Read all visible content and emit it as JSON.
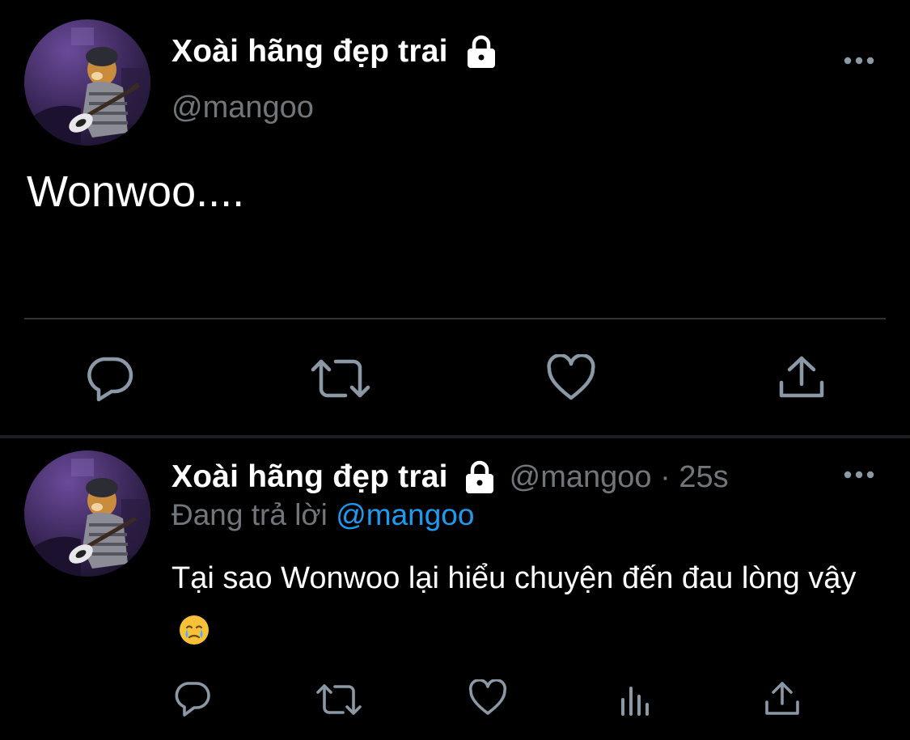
{
  "main_tweet": {
    "avatar": "dog-guitar-avatar",
    "display_name": "Xoài hãng đẹp trai",
    "handle": "@mangoo",
    "text": "Wonwoo....",
    "icons": {
      "lock": "lock-icon",
      "more": "more-icon",
      "reply": "reply-icon",
      "retweet": "retweet-icon",
      "like": "like-icon",
      "share": "share-icon"
    }
  },
  "reply_tweet": {
    "avatar": "dog-guitar-avatar",
    "display_name": "Xoài hãng đẹp trai",
    "meta": "@mangoo · 25s",
    "replying_prefix": "Đang trả lời",
    "replying_handle": "@mangoo",
    "text": "Tại sao Wonwoo lại hiểu chuyện đến đau lòng vậy",
    "emoji": "face-holding-back-tears-emoji",
    "icons": {
      "lock": "lock-icon",
      "more": "more-icon",
      "reply": "reply-icon",
      "retweet": "retweet-icon",
      "like": "like-icon",
      "stats": "stats-icon",
      "share": "share-icon"
    }
  },
  "colors": {
    "background": "#000000",
    "text_primary": "#ffffff",
    "text_secondary": "#71767b",
    "icon": "#8b98a5",
    "link": "#1d9bf0",
    "divider": "#2f3336"
  }
}
